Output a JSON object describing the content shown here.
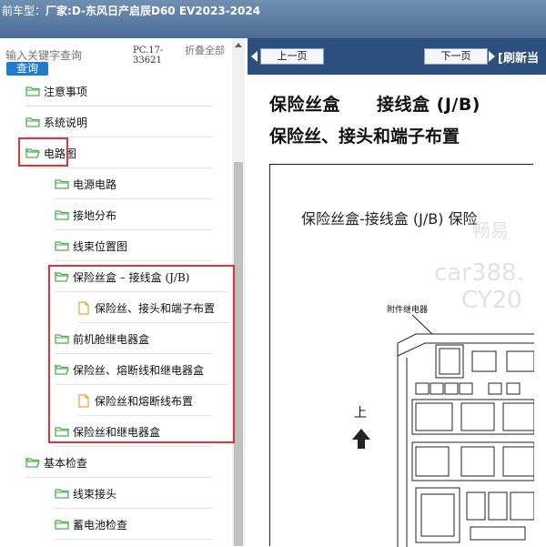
{
  "titlebar": {
    "prefix": "前车型：",
    "label": "厂家:D-东风日产启辰D60 EV2023-2024"
  },
  "search": {
    "placeholder": "输入关键字查询",
    "button": "查询",
    "pc_code": "PC.17-33621",
    "collapse_all": "折叠全部"
  },
  "tree": [
    {
      "label": "注意事项",
      "icon": "folder-icon"
    },
    {
      "label": "系统说明",
      "icon": "folder-icon"
    },
    {
      "label": "电路图",
      "icon": "folder-icon",
      "highlighted": true
    },
    {
      "label": "电源电路",
      "icon": "folder-icon"
    },
    {
      "label": "接地分布",
      "icon": "folder-icon"
    },
    {
      "label": "线束位置图",
      "icon": "folder-icon"
    },
    {
      "label": "保险丝盒 – 接线盒 (J/B)",
      "icon": "folder-icon",
      "highlighted": true
    },
    {
      "label": "保险丝、接头和端子布置",
      "icon": "document-icon",
      "highlighted": true
    },
    {
      "label": "前机舱继电器盒",
      "icon": "folder-icon",
      "highlighted": true
    },
    {
      "label": "保险丝、熔断线和继电器盒",
      "icon": "folder-icon",
      "highlighted": true
    },
    {
      "label": "保险丝和熔断线布置",
      "icon": "document-icon",
      "highlighted": true
    },
    {
      "label": "保险丝和继电器盒",
      "icon": "folder-icon",
      "highlighted": true
    },
    {
      "label": "基本检查",
      "icon": "folder-icon"
    },
    {
      "label": "线束接头",
      "icon": "folder-icon"
    },
    {
      "label": "蓄电池检查",
      "icon": "folder-icon"
    }
  ],
  "nav": {
    "prev": "上一页",
    "next": "下一页",
    "refresh": "[刷新当"
  },
  "doc": {
    "title_a": "保险丝盒",
    "title_b": "接线盒 (J/B)",
    "subtitle": "保险丝、接头和端子布置",
    "figure_caption": "保险丝盒-接线盒 (J/B) 保险",
    "relay_label": "附件继电器",
    "up_label": "上",
    "watermark_1": "畅易",
    "watermark_2": "car388.",
    "watermark_3": "CY20"
  },
  "colors": {
    "titlebar": "#5a7aa3",
    "navbar": "#2d4f7e",
    "highlight": "#e0333b",
    "search_button": "#1e7bd0",
    "folder": "#4caf50",
    "document": "#f0a030"
  }
}
